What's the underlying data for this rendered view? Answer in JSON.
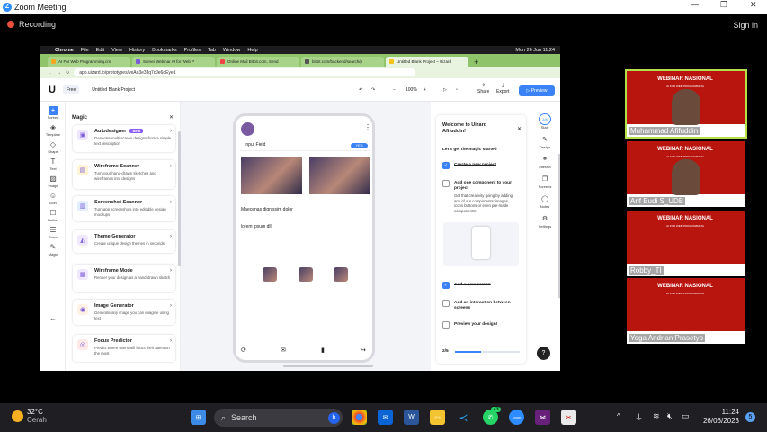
{
  "zoom": {
    "title": "Zoom Meeting",
    "recording": "Recording",
    "sign_in": "Sign in"
  },
  "mac_menu": [
    "Chrome",
    "File",
    "Edit",
    "View",
    "History",
    "Bookmarks",
    "Profiles",
    "Tab",
    "Window",
    "Help"
  ],
  "mac_clock": "Mon 26 Jun 11.24",
  "tabs": [
    "AI For Web Programming.cm",
    "Survei Webinar AI for Web P",
    "Online Mail Bitbit.com, Send",
    "bitbit.com/backend/search/p",
    "Untitled Blank Project – Uizard"
  ],
  "url": "app.uizard.io/prototypes/veAo3e3Jq7cJe6dEye1",
  "app": {
    "plan": "Free",
    "project": "Untitled Blank Project",
    "zoom": "100%",
    "share": "Share",
    "export": "Export",
    "preview": "Preview"
  },
  "rail": [
    "Screen",
    "Template",
    "Shape",
    "Text",
    "Image",
    "Icon",
    "Button",
    "Form",
    "Magic"
  ],
  "magic": {
    "title": "Magic",
    "cards": [
      {
        "title": "Autodesigner",
        "badge": "Beta",
        "desc": "Generate multi screen designs from a simple text description",
        "color": "#efe7ff",
        "icon": "▣"
      },
      {
        "title": "Wireframe Scanner",
        "badge": "",
        "desc": "Turn your hand-drawn sketches and wireframes into designs",
        "color": "#fff3d6",
        "icon": "▤"
      },
      {
        "title": "Screenshot Scanner",
        "badge": "",
        "desc": "Turn app screenshots into editable design mockups",
        "color": "#e3efff",
        "icon": "▥"
      },
      {
        "title": "Theme Generator",
        "badge": "",
        "desc": "Create unique design themes in seconds",
        "color": "#f0e8ff",
        "icon": "◭"
      },
      {
        "title": "Wireframe Mode",
        "badge": "",
        "desc": "Render your design as a hand-drawn sketch",
        "color": "#f0e8ff",
        "icon": "▦"
      },
      {
        "title": "Image Generator",
        "badge": "",
        "desc": "Generate any image you can imagine using text",
        "color": "#fff1e3",
        "icon": "◉"
      },
      {
        "title": "Focus Predictor",
        "badge": "",
        "desc": "Predict where users will focus their attention the most",
        "color": "#ffe9e9",
        "icon": "◎"
      }
    ]
  },
  "phone": {
    "input_label": "Input Field",
    "input_badge": "YES",
    "heading": "Maecenas dignissim dolor",
    "body": "lorem ipsum dlll"
  },
  "onboarding": {
    "title": "Welcome to Uizard Afifuddin!",
    "subtitle": "Let's get the magic started",
    "steps": [
      {
        "label": "Create a new project",
        "done": true,
        "desc": ""
      },
      {
        "label": "Add one component to your project",
        "done": false,
        "desc": "Get that creativity going by adding any of our components: images, icons buttons or even pre-made components!"
      },
      {
        "label": "Add a new screen",
        "done": true,
        "desc": ""
      },
      {
        "label": "Add an interaction between screens",
        "done": false,
        "desc": ""
      },
      {
        "label": "Preview your design!",
        "done": false,
        "desc": ""
      }
    ],
    "progress": "2/5",
    "progress_fraction": 0.4
  },
  "right_rail": [
    "Start",
    "Design",
    "Interact",
    "Screens",
    "Notes",
    "Settings"
  ],
  "right_rail_badge": "2/4",
  "participants": [
    {
      "name": "Muhammad Afifuddin",
      "banner": "WEBINAR NASIONAL"
    },
    {
      "name": "Arif Budi S_UDB",
      "banner": "WEBINAR NASIONAL"
    },
    {
      "name": "Robby_TI",
      "banner": "WEBINAR NASIONAL"
    },
    {
      "name": "Yoga Andrian Prasetyo",
      "banner": "WEBINAR NASIONAL"
    }
  ],
  "banner_sub": "AI FOR WEB PROGRAMMING",
  "taskbar": {
    "temp": "32°C",
    "weather": "Cerah",
    "search": "Search",
    "time": "11:24",
    "date": "26/06/2023",
    "whatsapp_badge": "73",
    "notif": "5"
  }
}
